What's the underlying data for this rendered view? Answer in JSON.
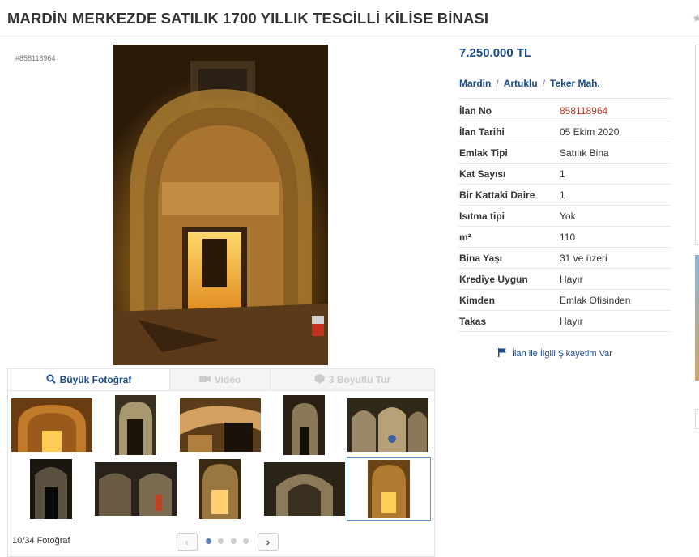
{
  "listing": {
    "title": "MARDİN MERKEZDE SATILIK 1700 YILLIK TESCİLLİ KİLİSE BİNASI",
    "listing_no_small": "#858118964",
    "price": "7.250.000 TL",
    "location": {
      "city": "Mardin",
      "district": "Artuklu",
      "neighborhood": "Teker Mah."
    },
    "details": [
      {
        "key": "İlan No",
        "value": "858118964",
        "highlight": true
      },
      {
        "key": "İlan Tarihi",
        "value": "05 Ekim 2020"
      },
      {
        "key": "Emlak Tipi",
        "value": "Satılık Bina"
      },
      {
        "key": "Kat Sayısı",
        "value": "1"
      },
      {
        "key": "Bir Kattaki Daire",
        "value": "1"
      },
      {
        "key": "Isıtma tipi",
        "value": "Yok"
      },
      {
        "key": "m²",
        "value": "110"
      },
      {
        "key": "Bina Yaşı",
        "value": "31 ve üzeri"
      },
      {
        "key": "Krediye Uygun",
        "value": "Hayır"
      },
      {
        "key": "Kimden",
        "value": "Emlak Ofisinden"
      },
      {
        "key": "Takas",
        "value": "Hayır"
      }
    ],
    "complaint_link": "İlan ile İlgili Şikayetim Var"
  },
  "gallery": {
    "tabs": {
      "large_photo": "Büyük Fotoğraf",
      "video": "Video",
      "tour": "3 Boyutlu Tur"
    },
    "photo_count": "10/34 Fotoğraf",
    "current_page": 1,
    "total_pages": 4,
    "selected_thumb": 10
  },
  "colors": {
    "link_blue": "#1a4b8c",
    "highlight_red": "#c0392b",
    "tab_bg": "#f4f4f4"
  },
  "icons": {
    "search": "search-icon",
    "video": "video-camera-icon",
    "tour": "cube-icon",
    "flag": "flag-icon",
    "prev": "chevron-left-icon",
    "next": "chevron-right-icon",
    "star": "star-icon"
  }
}
